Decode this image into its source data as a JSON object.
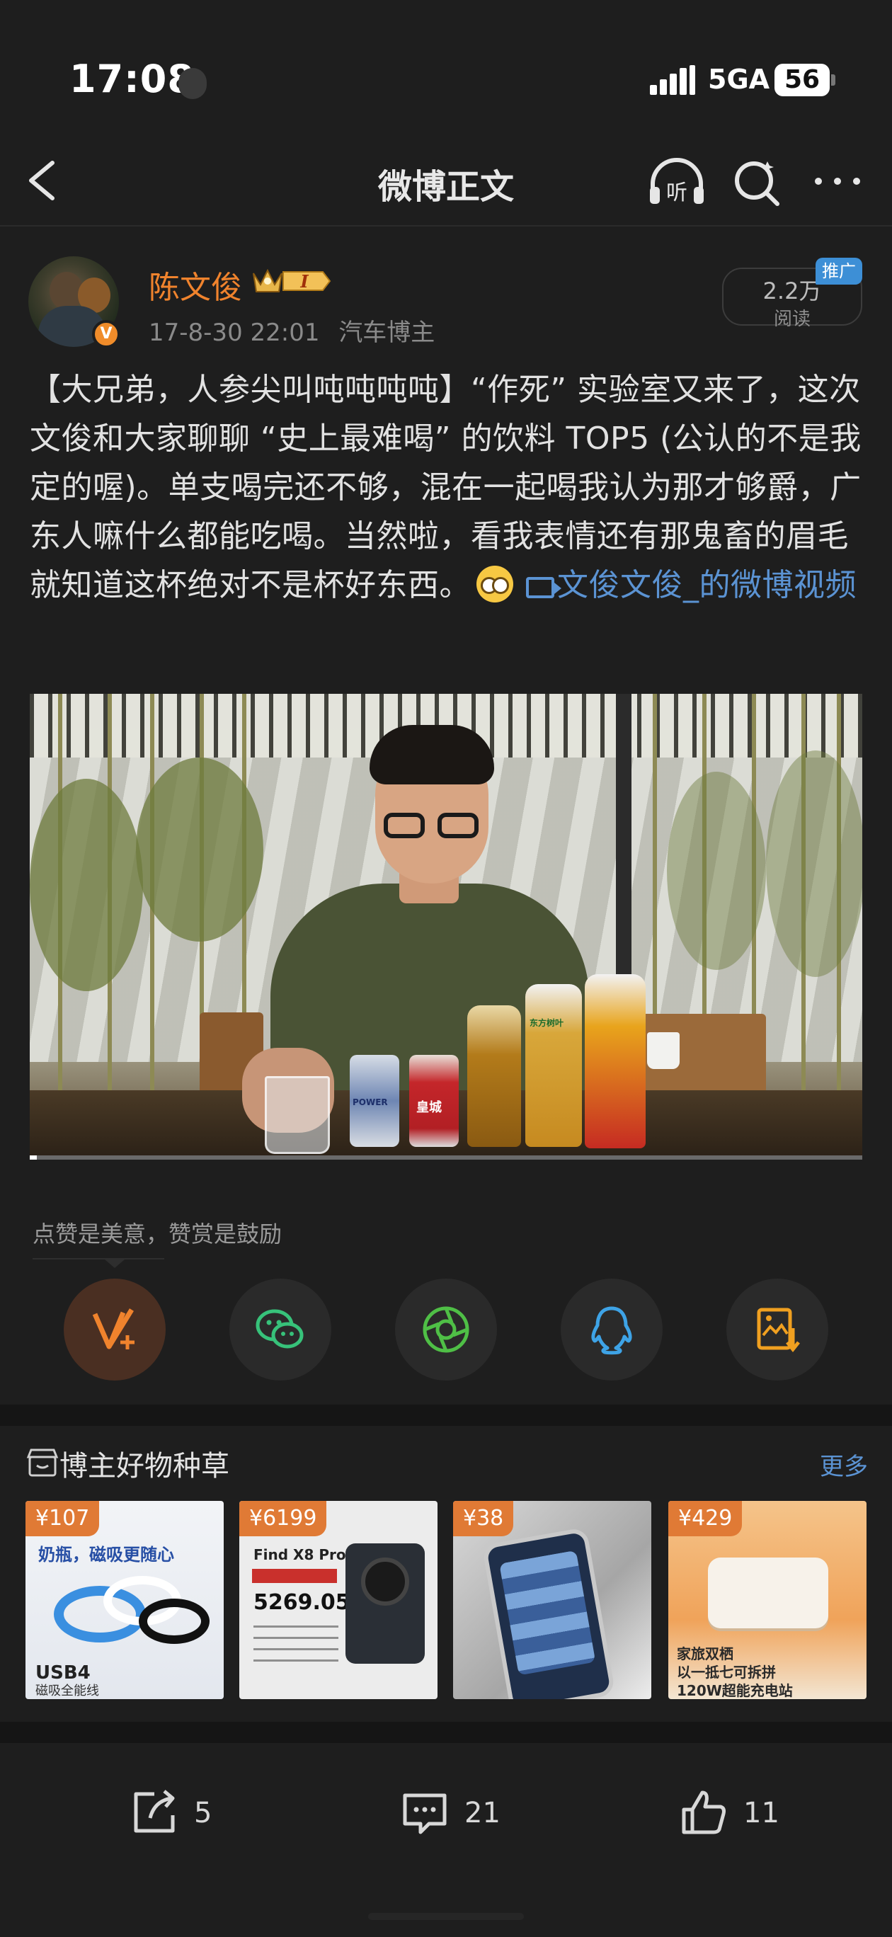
{
  "status_bar": {
    "time": "17:08",
    "network": "5GA",
    "battery": "56"
  },
  "nav": {
    "title": "微博正文",
    "listen_label": "听"
  },
  "post": {
    "author": "陈文俊",
    "verified_badge": "V",
    "level_badge": "I",
    "date": "17-8-30 22:01",
    "source": "汽车博主",
    "read_count": "2.2万",
    "read_label": "阅读",
    "promo_tag": "推广",
    "text_main": "【大兄弟，人参尖叫吨吨吨吨】“作死” 实验室又来了，这次文俊和大家聊聊 “史上最难喝” 的饮料 TOP5 (公认的不是我定的喔)。单支喝完还不够，混在一起喝我认为那才够爵，广东人嘛什么都能吃喝。当然啦，看我表情还有那鬼畜的眉毛就知道这杯绝对不是杯好东西。",
    "video_link": "文俊文俊_的微博视频"
  },
  "video": {
    "can_1_text": "POWER",
    "can_2_text": "皇城",
    "bottle_text": "东方树叶"
  },
  "reward": {
    "tip": "点赞是美意，赞赏是鼓励",
    "share_targets": [
      "v-plus",
      "wechat",
      "moments",
      "qq",
      "save-image"
    ]
  },
  "products": {
    "title": "博主好物种草",
    "more": "更多",
    "items": [
      {
        "price": "¥107",
        "line1": "奶瓶，磁吸更随心",
        "line2": "USB4",
        "line3": "磁吸全能线"
      },
      {
        "price": "¥6199",
        "line1": "Find X8 Pro",
        "line2": "5269.05"
      },
      {
        "price": "¥38"
      },
      {
        "price": "¥429",
        "line1": "家旅双栖",
        "line2": "以一抵七可拆拼",
        "line3": "120W超能充电站"
      }
    ]
  },
  "bottom_bar": {
    "repost_count": "5",
    "comment_count": "21",
    "like_count": "11"
  },
  "colors": {
    "background": "#1e1e1e",
    "author_orange": "#f0832d",
    "link_blue": "#5b93d3",
    "price_orange": "#e07a35"
  }
}
